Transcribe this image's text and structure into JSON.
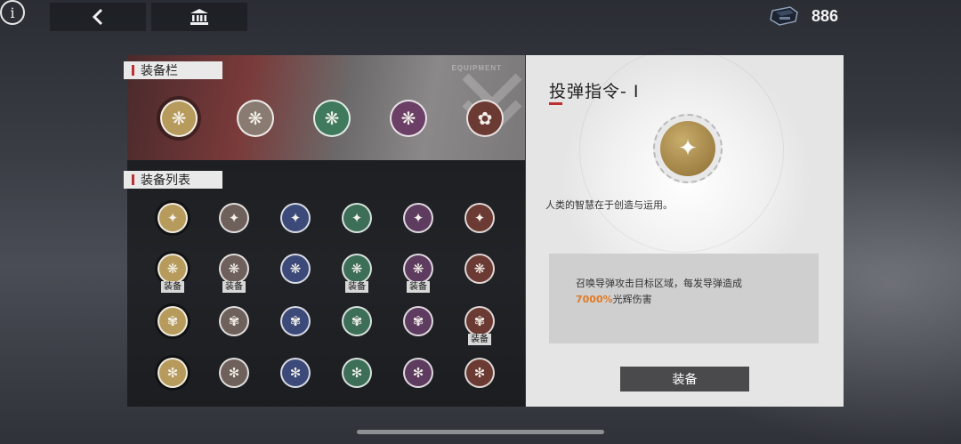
{
  "topbar": {
    "back_icon": "chevron-left",
    "museum_icon": "museum",
    "info_glyph": "i",
    "currency_icon": "chip-device",
    "currency_value": "886"
  },
  "equip_bar": {
    "label": "装备栏",
    "deco_text": "EQUIPMENT",
    "slots": [
      {
        "color": "#b79b5c",
        "glyph": "❋"
      },
      {
        "color": "#8a7b72",
        "glyph": "❋"
      },
      {
        "color": "#3f7a5c",
        "glyph": "❋"
      },
      {
        "color": "#6b3f66",
        "glyph": "❋"
      },
      {
        "color": "#6a3a33",
        "glyph": "✿"
      }
    ]
  },
  "equip_list": {
    "label": "装备列表",
    "tag_text": "装备",
    "rows": [
      [
        {
          "color": "#b79b5c",
          "glyph": "✦",
          "tag": false
        },
        {
          "color": "#6e605a",
          "glyph": "✦",
          "tag": false
        },
        {
          "color": "#3c4a7a",
          "glyph": "✦",
          "tag": false
        },
        {
          "color": "#3d6e58",
          "glyph": "✦",
          "tag": false
        },
        {
          "color": "#5e3c60",
          "glyph": "✦",
          "tag": false
        },
        {
          "color": "#6a3a33",
          "glyph": "✦",
          "tag": false
        }
      ],
      [
        {
          "color": "#b79b5c",
          "glyph": "❋",
          "tag": true
        },
        {
          "color": "#6e605a",
          "glyph": "❋",
          "tag": true
        },
        {
          "color": "#3c4a7a",
          "glyph": "❋",
          "tag": false
        },
        {
          "color": "#3d6e58",
          "glyph": "❋",
          "tag": true
        },
        {
          "color": "#5e3c60",
          "glyph": "❋",
          "tag": true
        },
        {
          "color": "#6a3a33",
          "glyph": "❋",
          "tag": false
        }
      ],
      [
        {
          "color": "#b79b5c",
          "glyph": "✾",
          "tag": false
        },
        {
          "color": "#6e605a",
          "glyph": "✾",
          "tag": false
        },
        {
          "color": "#3c4a7a",
          "glyph": "✾",
          "tag": false
        },
        {
          "color": "#3d6e58",
          "glyph": "✾",
          "tag": false
        },
        {
          "color": "#5e3c60",
          "glyph": "✾",
          "tag": false
        },
        {
          "color": "#6a3a33",
          "glyph": "✾",
          "tag": true
        }
      ],
      [
        {
          "color": "#b79b5c",
          "glyph": "✻",
          "tag": false
        },
        {
          "color": "#6e605a",
          "glyph": "✻",
          "tag": false
        },
        {
          "color": "#3c4a7a",
          "glyph": "✻",
          "tag": false
        },
        {
          "color": "#3d6e58",
          "glyph": "✻",
          "tag": false
        },
        {
          "color": "#5e3c60",
          "glyph": "✻",
          "tag": false
        },
        {
          "color": "#6a3a33",
          "glyph": "✻",
          "tag": false
        }
      ]
    ]
  },
  "detail": {
    "title": "投弹指令- I",
    "icon_glyph": "✦",
    "flavor": "人类的智慧在于创造与运用。",
    "desc_line1": "召唤导弹攻击目标区域，每发导弹造成",
    "desc_highlight": "7000%",
    "desc_line2_rest": "光辉伤害",
    "button_label": "装备"
  }
}
